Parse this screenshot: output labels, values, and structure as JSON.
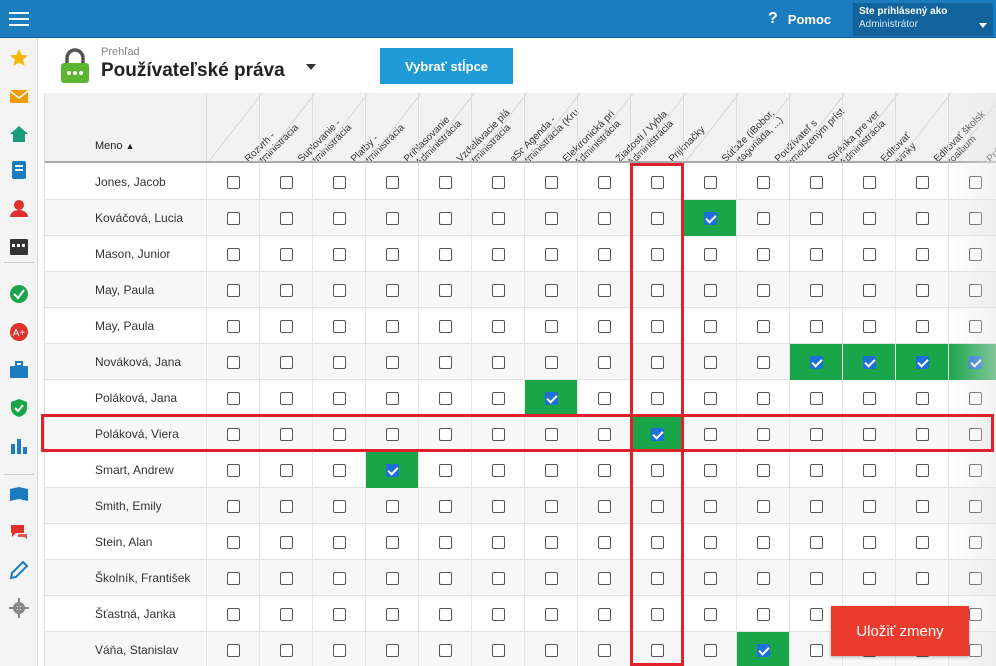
{
  "topbar": {
    "help_label": "Pomoc",
    "help_icon": "question-icon",
    "user_line1": "Ste prihlásený ako",
    "user_line2": "Administrátor"
  },
  "sidebar_icons": [
    {
      "name": "star-icon",
      "color": "#f5b800"
    },
    {
      "name": "mail-icon",
      "color": "#f29b00"
    },
    {
      "name": "home-icon",
      "color": "#1a9c7c"
    },
    {
      "name": "notebook-icon",
      "color": "#1a7bbf"
    },
    {
      "name": "person-icon",
      "color": "#e0302b"
    },
    {
      "name": "calendar-icon",
      "color": "#333333"
    },
    {
      "name": "check-circle-icon",
      "color": "#1aa54b"
    },
    {
      "name": "grade-icon",
      "color": "#e0302b"
    },
    {
      "name": "briefcase-icon",
      "color": "#1a7bbf"
    },
    {
      "name": "shield-check-icon",
      "color": "#1aa54b"
    },
    {
      "name": "bar-chart-icon",
      "color": "#1a7bbf"
    },
    {
      "name": "book-icon",
      "color": "#1a7bbf"
    },
    {
      "name": "chat-icon",
      "color": "#e0302b"
    },
    {
      "name": "pen-icon",
      "color": "#1a7bbf"
    },
    {
      "name": "gear-icon",
      "color": "#888888"
    }
  ],
  "header": {
    "breadcrumb": "Prehľad",
    "title": "Používateľské práva",
    "select_columns_label": "Vybrať stĺpce"
  },
  "table": {
    "name_header": "Meno",
    "sort_arrow": "▲",
    "columns": [
      [
        "Rozvrh -",
        "Administrácia"
      ],
      [
        "Suplovanie -",
        "Administrácia"
      ],
      [
        "Platby -",
        "Administrácia"
      ],
      [
        "Prihlasovanie",
        "- Administrácia"
      ],
      [
        "Vzdelávacie plá",
        "Administrácia"
      ],
      [
        "aSc Agenda -",
        "Administrácia (Kru"
      ],
      [
        "Elektronická pri",
        "- Administrácia"
      ],
      [
        "Žiadosti / Vybla",
        "- Administrácia"
      ],
      [
        "Prijímačky",
        ""
      ],
      [
        "Súťaže (iBobor,",
        "Pytagoriáda, ...)"
      ],
      [
        "Používateľ s",
        "obmedzeným príst"
      ],
      [
        "Stránka pre ver",
        "- Administrácia"
      ],
      [
        "Editovať",
        "novinky"
      ],
      [
        "Editovať školsk",
        "fotoalbum"
      ],
      [
        "Prá",
        "Ad"
      ]
    ],
    "rows": [
      {
        "name": "Jones, Jacob",
        "checked": []
      },
      {
        "name": "Kováčová, Lucia",
        "checked": [
          9
        ]
      },
      {
        "name": "Mason, Junior",
        "checked": []
      },
      {
        "name": "May, Paula",
        "checked": []
      },
      {
        "name": "May, Paula",
        "checked": []
      },
      {
        "name": "Nováková, Jana",
        "checked": [
          11,
          12,
          13,
          14
        ]
      },
      {
        "name": "Poláková, Jana",
        "checked": [
          6
        ]
      },
      {
        "name": "Poláková, Viera",
        "checked": [
          8
        ]
      },
      {
        "name": "Smart, Andrew",
        "checked": [
          3
        ]
      },
      {
        "name": "Smith, Emily",
        "checked": []
      },
      {
        "name": "Stein, Alan",
        "checked": []
      },
      {
        "name": "Školník, František",
        "checked": []
      },
      {
        "name": "Šťastná, Janka",
        "checked": []
      },
      {
        "name": "Váňa, Stanislav",
        "checked": [
          10
        ]
      }
    ]
  },
  "save_label": "Uložiť zmeny",
  "colors": {
    "topbar": "#1a7bbf",
    "checked_cell": "#1aa54b",
    "highlight": "#e0202b",
    "save_button": "#ec3b2e",
    "columns_button": "#1e9bd7"
  }
}
